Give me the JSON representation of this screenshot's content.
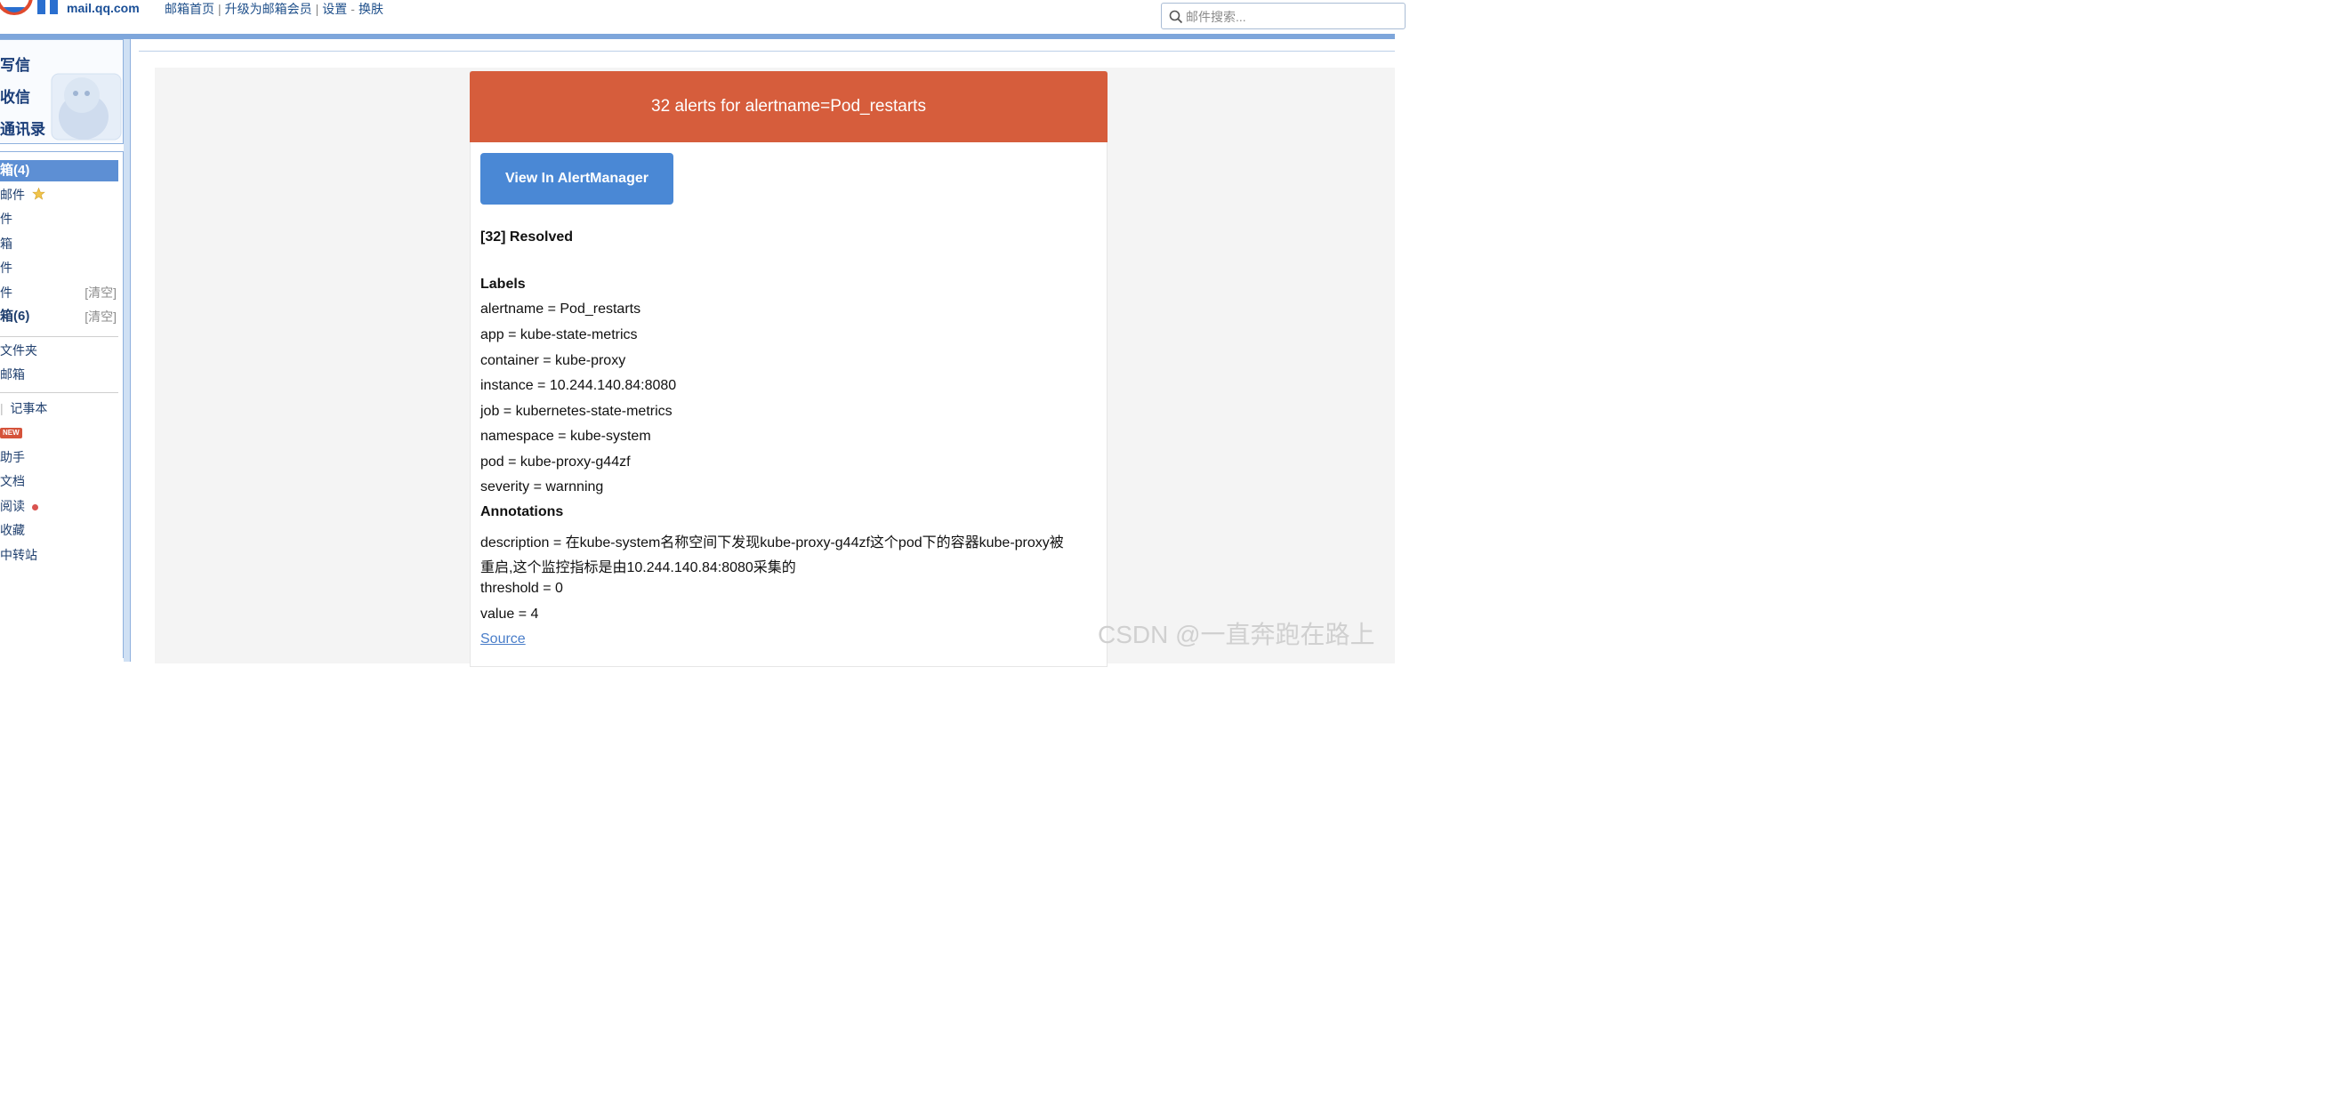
{
  "header": {
    "logo_text": "mail.qq.com",
    "nav": [
      "邮箱首页",
      "升级为邮箱会员",
      "设置",
      "换肤"
    ],
    "nav_separators": [
      "|",
      "|",
      "-"
    ],
    "search_placeholder": "邮件搜索..."
  },
  "sidebar": {
    "quick_links": [
      "写信",
      "收信",
      "通讯录"
    ],
    "folders": [
      {
        "label": "箱(4)"
      },
      {
        "label": "邮件"
      },
      {
        "label": "件"
      },
      {
        "label": "箱"
      },
      {
        "label": "件"
      },
      {
        "label": "件",
        "action": "[清空]"
      },
      {
        "label": "箱(6)",
        "action": "[清空]"
      }
    ],
    "groups": [
      "文件夹",
      "邮箱"
    ],
    "apps": [
      "记事本",
      "NEW",
      "助手",
      "文档",
      "阅读",
      "收藏",
      "中转站"
    ]
  },
  "alert": {
    "header": "32 alerts for alertname=Pod_restarts",
    "button": "View In AlertManager",
    "status": "[32] Resolved",
    "labels_title": "Labels",
    "labels": [
      "alertname = Pod_restarts",
      "app = kube-state-metrics",
      "container = kube-proxy",
      "instance = 10.244.140.84:8080",
      "job = kubernetes-state-metrics",
      "namespace = kube-system",
      "pod = kube-proxy-g44zf",
      "severity = warnning"
    ],
    "annotations_title": "Annotations",
    "annotations": [
      "description = 在kube-system名称空间下发现kube-proxy-g44zf这个pod下的容器kube-proxy被",
      "重启,这个监控指标是由10.244.140.84:8080采集的",
      "threshold = 0",
      "value = 4"
    ],
    "source_link": "Source"
  },
  "watermark": "CSDN @一直奔跑在路上"
}
